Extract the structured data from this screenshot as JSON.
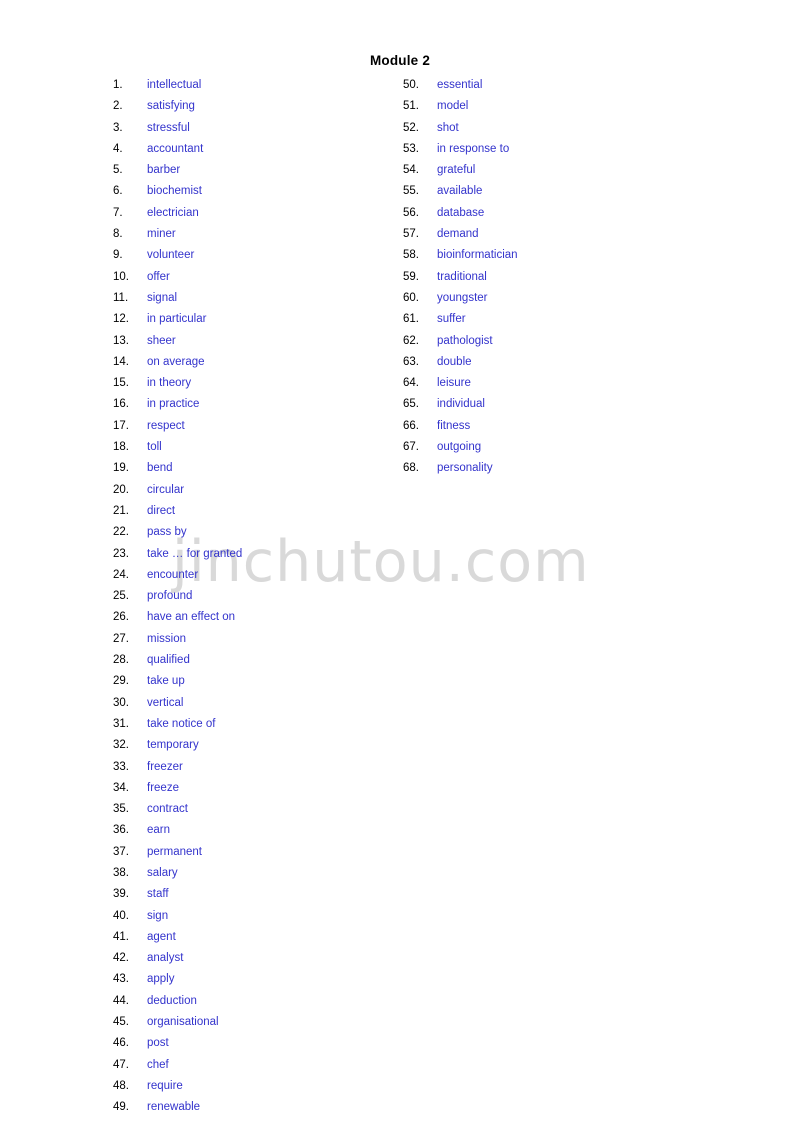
{
  "document": {
    "title": "Module 2",
    "watermark": "jinchutou.com",
    "term_color": "#3333cc",
    "number_color": "#000000",
    "title_color": "#000000",
    "watermark_color": "#d9d9d9",
    "background_color": "#ffffff"
  },
  "columns": {
    "left": [
      {
        "number": "1.",
        "term": "intellectual"
      },
      {
        "number": "2.",
        "term": "satisfying"
      },
      {
        "number": "3.",
        "term": "stressful"
      },
      {
        "number": "4.",
        "term": "accountant"
      },
      {
        "number": "5.",
        "term": "barber"
      },
      {
        "number": "6.",
        "term": "biochemist"
      },
      {
        "number": "7.",
        "term": "electrician"
      },
      {
        "number": "8.",
        "term": "miner"
      },
      {
        "number": "9.",
        "term": "volunteer"
      },
      {
        "number": "10.",
        "term": "offer"
      },
      {
        "number": "11.",
        "term": "signal"
      },
      {
        "number": "12.",
        "term": "in particular"
      },
      {
        "number": "13.",
        "term": "sheer"
      },
      {
        "number": "14.",
        "term": "on average"
      },
      {
        "number": "15.",
        "term": "in theory"
      },
      {
        "number": "16.",
        "term": "in practice"
      },
      {
        "number": "17.",
        "term": "respect"
      },
      {
        "number": "18.",
        "term": "toll"
      },
      {
        "number": "19.",
        "term": "bend"
      },
      {
        "number": "20.",
        "term": "circular"
      },
      {
        "number": "21.",
        "term": "direct"
      },
      {
        "number": "22.",
        "term": "pass by"
      },
      {
        "number": "23.",
        "term": "take … for granted"
      },
      {
        "number": "24.",
        "term": "encounter"
      },
      {
        "number": "25.",
        "term": "profound"
      },
      {
        "number": "26.",
        "term": "have an effect on"
      },
      {
        "number": "27.",
        "term": "mission"
      },
      {
        "number": "28.",
        "term": "qualified"
      },
      {
        "number": "29.",
        "term": "take up"
      },
      {
        "number": "30.",
        "term": "vertical"
      },
      {
        "number": "31.",
        "term": "take notice of"
      },
      {
        "number": "32.",
        "term": "temporary"
      },
      {
        "number": "33.",
        "term": "freezer"
      },
      {
        "number": "34.",
        "term": "freeze"
      },
      {
        "number": "35.",
        "term": "contract"
      },
      {
        "number": "36.",
        "term": "earn"
      },
      {
        "number": "37.",
        "term": "permanent"
      },
      {
        "number": "38.",
        "term": "salary"
      },
      {
        "number": "39.",
        "term": "staff"
      },
      {
        "number": "40.",
        "term": "sign"
      },
      {
        "number": "41.",
        "term": "agent"
      },
      {
        "number": "42.",
        "term": "analyst"
      },
      {
        "number": "43.",
        "term": "apply"
      },
      {
        "number": "44.",
        "term": "deduction"
      },
      {
        "number": "45.",
        "term": "organisational"
      },
      {
        "number": "46.",
        "term": "post"
      },
      {
        "number": "47.",
        "term": "chef"
      },
      {
        "number": "48.",
        "term": "require"
      },
      {
        "number": "49.",
        "term": "renewable"
      }
    ],
    "right": [
      {
        "number": "50.",
        "term": "essential"
      },
      {
        "number": "51.",
        "term": "model"
      },
      {
        "number": "52.",
        "term": "shot"
      },
      {
        "number": "53.",
        "term": "in response to"
      },
      {
        "number": "54.",
        "term": "grateful"
      },
      {
        "number": "55.",
        "term": "available"
      },
      {
        "number": "56.",
        "term": "database"
      },
      {
        "number": "57.",
        "term": "demand"
      },
      {
        "number": "58.",
        "term": "bioinformatician"
      },
      {
        "number": "59.",
        "term": "traditional"
      },
      {
        "number": "60.",
        "term": "youngster"
      },
      {
        "number": "61.",
        "term": "suffer"
      },
      {
        "number": "62.",
        "term": "pathologist"
      },
      {
        "number": "63.",
        "term": "double"
      },
      {
        "number": "64.",
        "term": "leisure"
      },
      {
        "number": "65.",
        "term": "individual"
      },
      {
        "number": "66.",
        "term": "fitness"
      },
      {
        "number": "67.",
        "term": "outgoing"
      },
      {
        "number": "68.",
        "term": "personality"
      }
    ]
  }
}
